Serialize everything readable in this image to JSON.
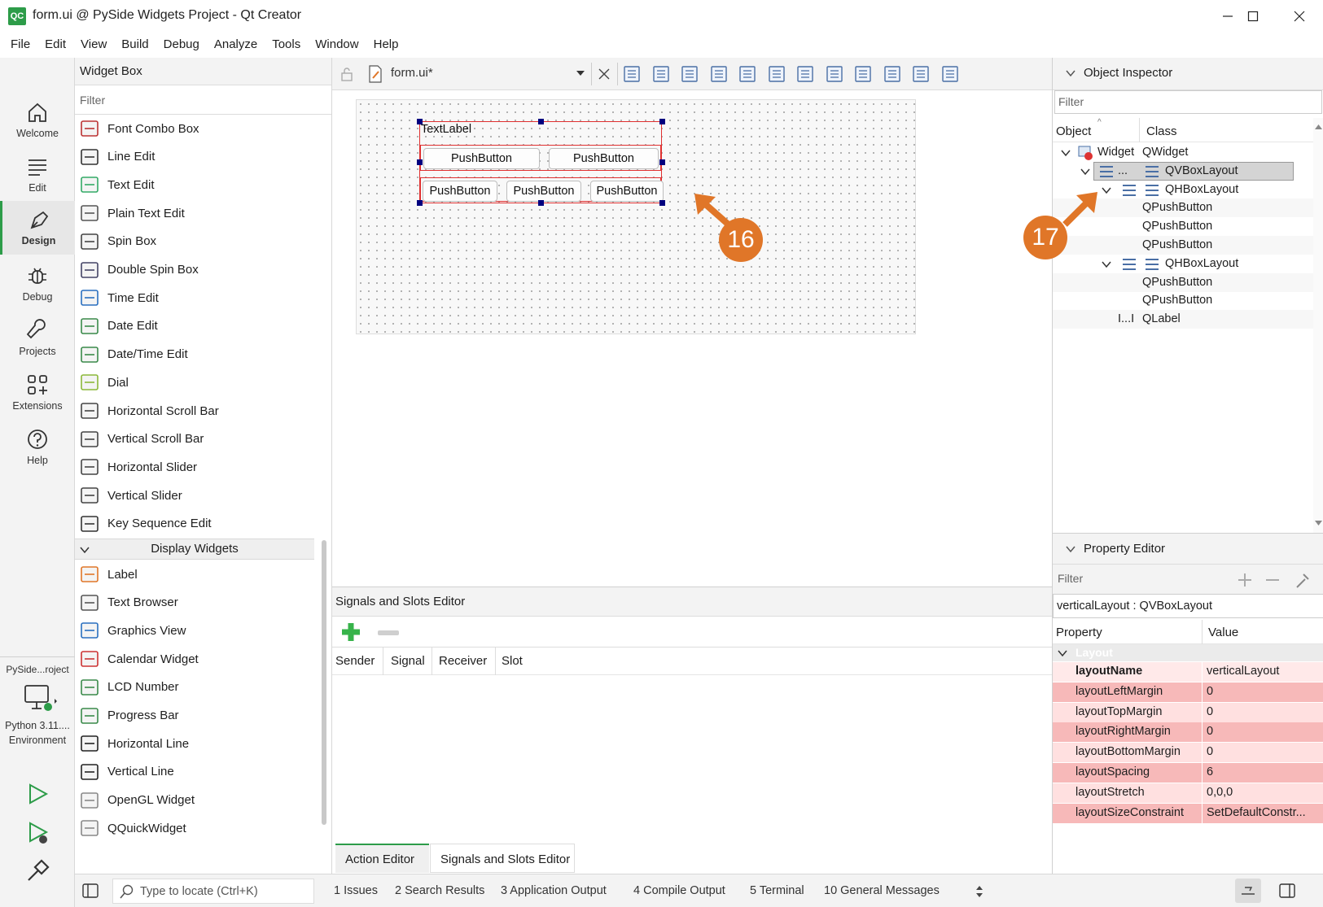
{
  "window": {
    "title": "form.ui @ PySide Widgets Project - Qt Creator",
    "logo": "QC"
  },
  "menu": [
    "File",
    "Edit",
    "View",
    "Build",
    "Debug",
    "Analyze",
    "Tools",
    "Window",
    "Help"
  ],
  "modes": [
    {
      "label": "Welcome",
      "icon": "home-icon"
    },
    {
      "label": "Edit",
      "icon": "edit-lines-icon"
    },
    {
      "label": "Design",
      "icon": "pen-icon"
    },
    {
      "label": "Debug",
      "icon": "bug-icon"
    },
    {
      "label": "Projects",
      "icon": "wrench-icon"
    },
    {
      "label": "Extensions",
      "icon": "grid-plus-icon"
    },
    {
      "label": "Help",
      "icon": "question-icon"
    }
  ],
  "kit": {
    "project": "PySide...roject",
    "env": "Python 3.11....",
    "env2": "Environment"
  },
  "widget_box": {
    "title": "Widget Box",
    "filter": "Filter",
    "input_items": [
      "Font Combo Box",
      "Line Edit",
      "Text Edit",
      "Plain Text Edit",
      "Spin Box",
      "Double Spin Box",
      "Time Edit",
      "Date Edit",
      "Date/Time Edit",
      "Dial",
      "Horizontal Scroll Bar",
      "Vertical Scroll Bar",
      "Horizontal Slider",
      "Vertical Slider",
      "Key Sequence Edit"
    ],
    "display_header": "Display Widgets",
    "display_items": [
      "Label",
      "Text Browser",
      "Graphics View",
      "Calendar Widget",
      "LCD Number",
      "Progress Bar",
      "Horizontal Line",
      "Vertical Line",
      "OpenGL Widget",
      "QQuickWidget"
    ]
  },
  "editor": {
    "file": "form.ui*"
  },
  "form": {
    "label": "TextLabel",
    "row1": [
      "PushButton",
      "PushButton"
    ],
    "row2": [
      "PushButton",
      "PushButton",
      "PushButton"
    ]
  },
  "callouts": {
    "a": "16",
    "b": "17"
  },
  "signals": {
    "title": "Signals and Slots Editor",
    "columns": [
      "Sender",
      "Signal",
      "Receiver",
      "Slot"
    ],
    "tabs": [
      "Action Editor",
      "Signals and Slots Editor"
    ]
  },
  "object_inspector": {
    "title": "Object Inspector",
    "filter": "Filter",
    "col_object": "Object",
    "col_class": "Class",
    "rows": [
      {
        "obj": "Widget",
        "cls": "QWidget"
      },
      {
        "obj": "...",
        "cls": "QVBoxLayout"
      },
      {
        "obj": "",
        "cls": "QHBoxLayout"
      },
      {
        "obj": "",
        "cls": "QPushButton"
      },
      {
        "obj": "",
        "cls": "QPushButton"
      },
      {
        "obj": "",
        "cls": "QPushButton"
      },
      {
        "obj": "",
        "cls": "QHBoxLayout"
      },
      {
        "obj": "",
        "cls": "QPushButton"
      },
      {
        "obj": "",
        "cls": "QPushButton"
      },
      {
        "obj": "I...I",
        "cls": "QLabel"
      }
    ]
  },
  "property_editor": {
    "title": "Property Editor",
    "filter": "Filter",
    "object": "verticalLayout : QVBoxLayout",
    "col_property": "Property",
    "col_value": "Value",
    "group": "Layout",
    "rows": [
      {
        "name": "layoutName",
        "value": "verticalLayout",
        "bold": true
      },
      {
        "name": "layoutLeftMargin",
        "value": "0"
      },
      {
        "name": "layoutTopMargin",
        "value": "0"
      },
      {
        "name": "layoutRightMargin",
        "value": "0"
      },
      {
        "name": "layoutBottomMargin",
        "value": "0"
      },
      {
        "name": "layoutSpacing",
        "value": "6"
      },
      {
        "name": "layoutStretch",
        "value": "0,0,0"
      },
      {
        "name": "layoutSizeConstraint",
        "value": "SetDefaultConstr..."
      }
    ]
  },
  "status": {
    "locator": "Type to locate (Ctrl+K)",
    "panes": [
      "1  Issues",
      "2  Search Results",
      "3  Application Output",
      "4  Compile Output",
      "5  Terminal",
      "10  General Messages"
    ]
  }
}
